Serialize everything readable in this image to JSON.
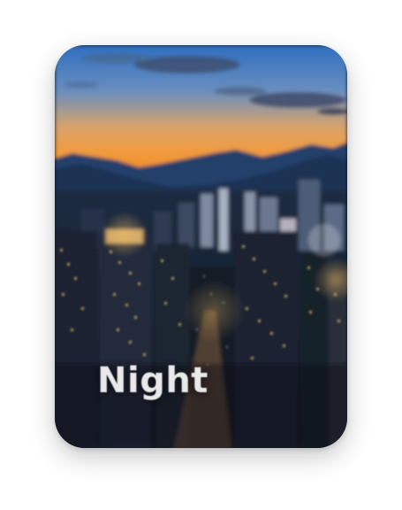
{
  "card": {
    "title": "Night",
    "image_subject": "city-skyline-at-dusk"
  },
  "colors": {
    "sky_top": "#3b78c4",
    "sky_horizon": "#f39a3a",
    "mountains": "#1f3a5f",
    "city_dark": "#141c28",
    "window_light": "#f2c56b",
    "label_text": "#e9e9e9"
  }
}
